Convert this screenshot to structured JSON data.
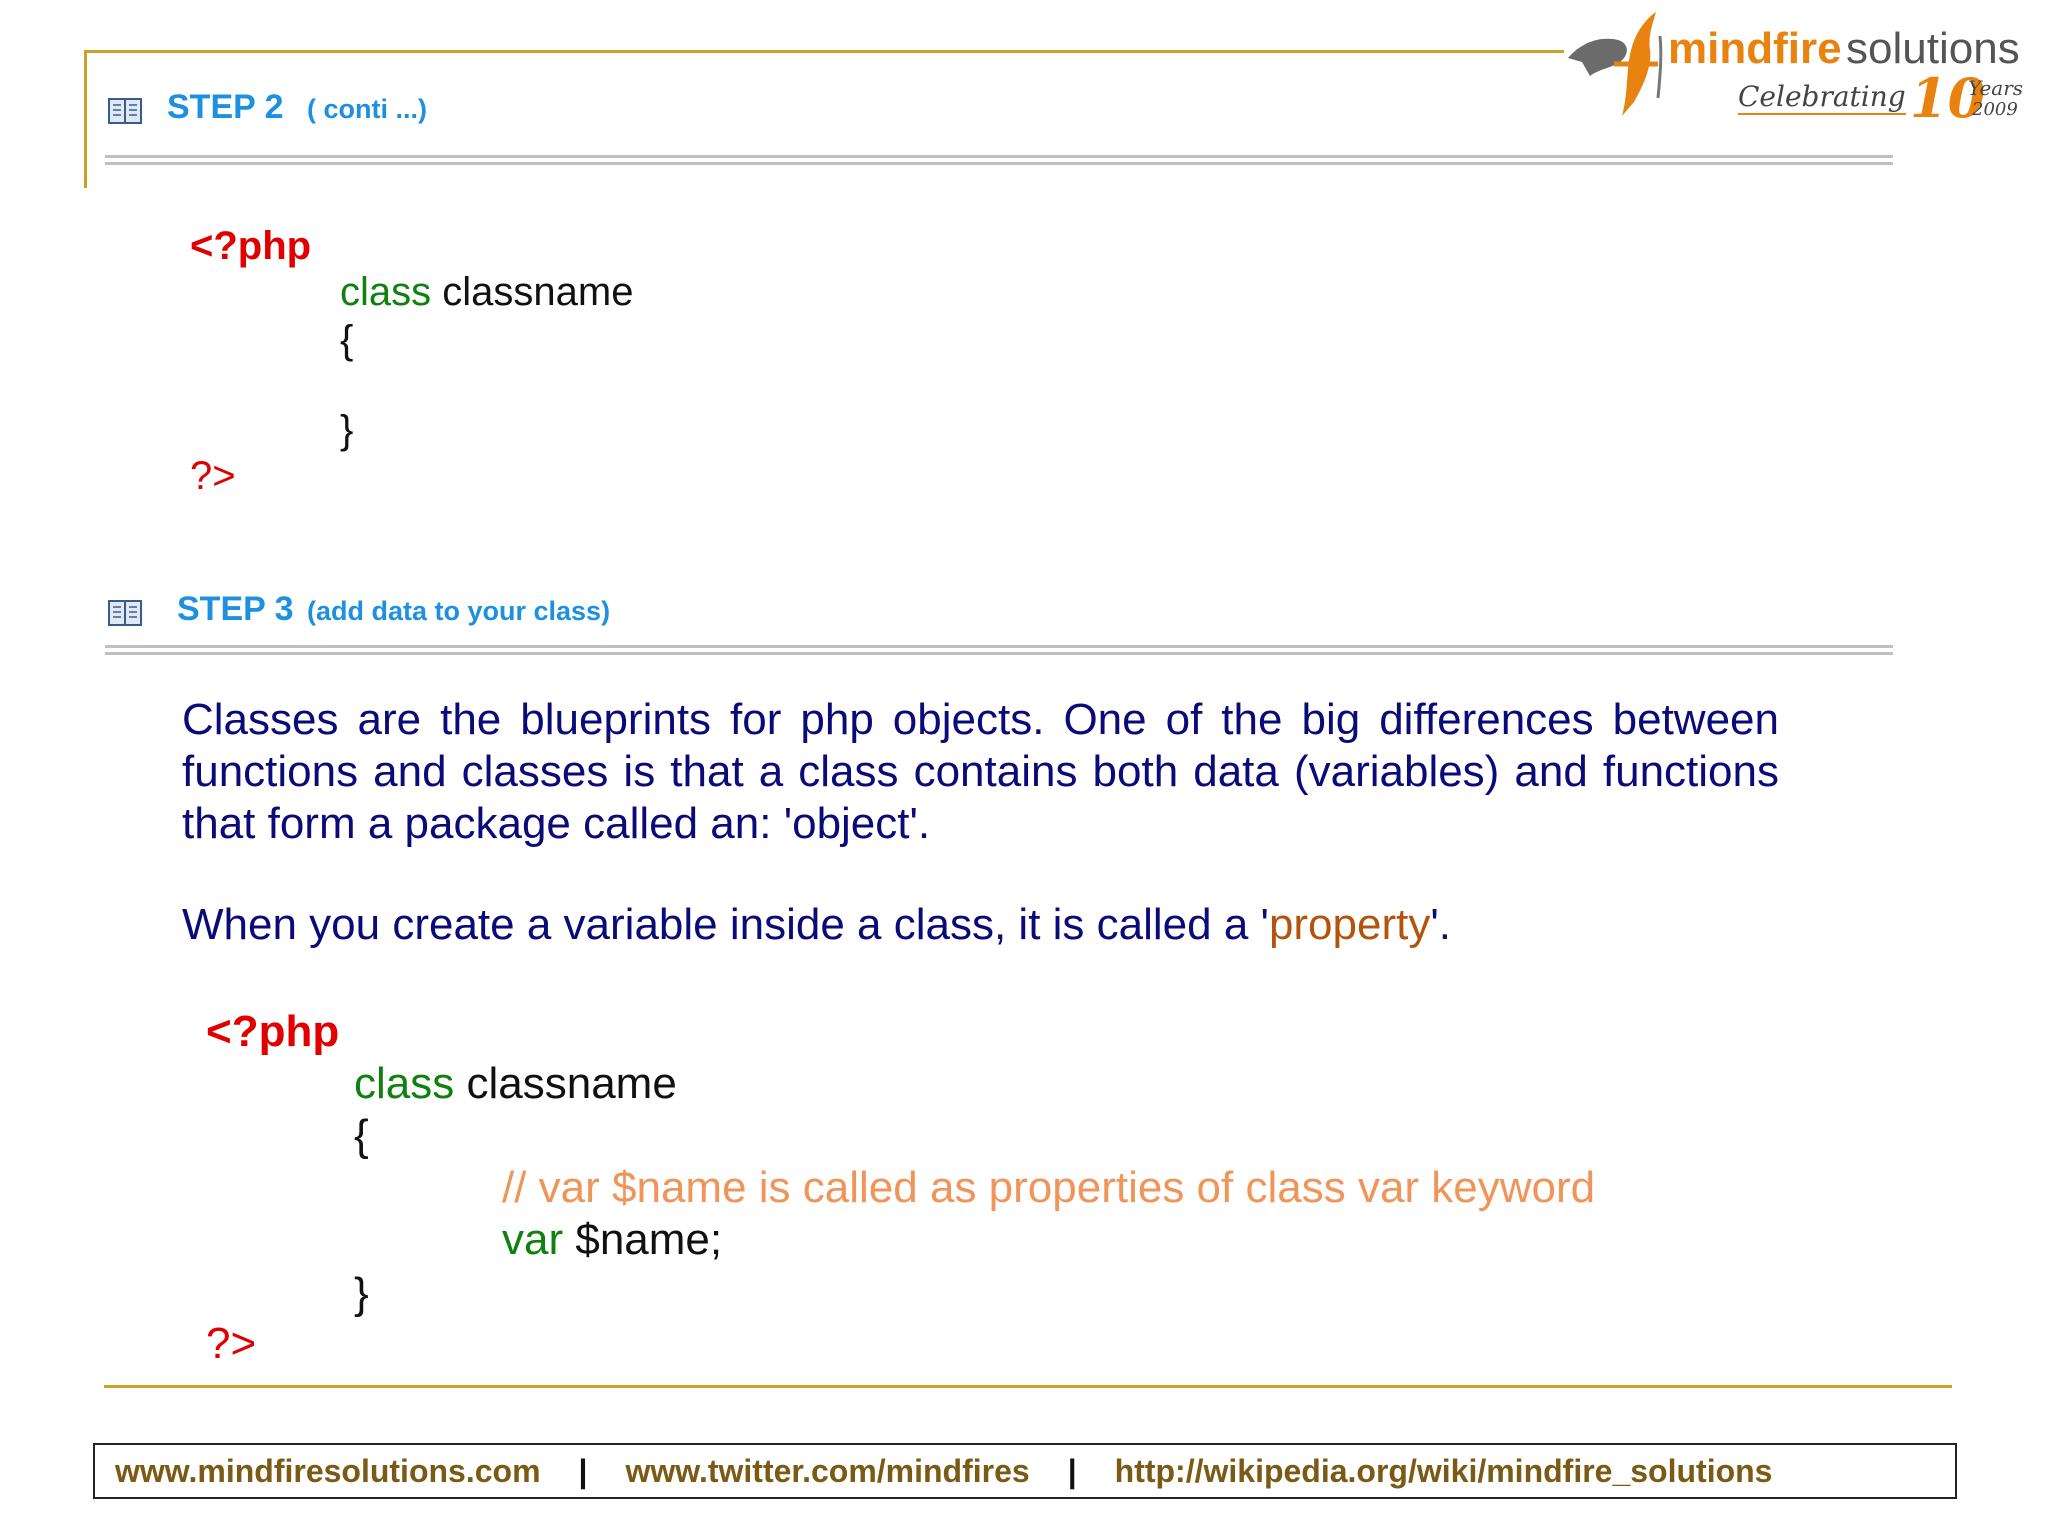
{
  "logo": {
    "brand_primary": "mindfire",
    "brand_secondary": "solutions",
    "tagline": "Celebrating",
    "years_number": "10",
    "years_label": "Years",
    "years_year": "2009"
  },
  "step2": {
    "title": "STEP 2",
    "subtitle": "( conti ...)",
    "code": {
      "open_tag": "<?php",
      "class_kw": "class",
      "class_name": "classname",
      "brace_open": "{",
      "brace_close": "}",
      "close_tag": "?>"
    }
  },
  "step3": {
    "title": "STEP 3",
    "subtitle": "(add data to your class)",
    "paragraph": "Classes are the blueprints for php objects. One of the big differences between functions and classes is that a class contains both data (variables) and functions that form a package called an: 'object'.",
    "property_sentence": {
      "before": "When you create a variable inside a class, it is called a '",
      "highlight": "property",
      "after": "'."
    },
    "code": {
      "open_tag": "<?php",
      "class_kw": "class",
      "class_name": "classname",
      "brace_open": "{",
      "comment": "// var $name is called as properties of class var keyword",
      "var_kw": "var",
      "var_name": "$name;",
      "brace_close": "}",
      "close_tag": "?>"
    }
  },
  "footer": {
    "link1": "www.mindfiresolutions.com",
    "separator": "|",
    "link2": "www.twitter.com/mindfires",
    "link3": "http://wikipedia.org/wiki/mindfire_solutions"
  },
  "colors": {
    "accent_blue": "#1e90e0",
    "php_tag_red": "#e00000",
    "keyword_green": "#108010",
    "comment_orange": "#f0955a",
    "body_navy": "#0a0a78",
    "frame_gold": "#c9a227"
  },
  "icons": {
    "step_icon": "open-book-icon",
    "logo_icon": "mindfire-flame-logo"
  }
}
